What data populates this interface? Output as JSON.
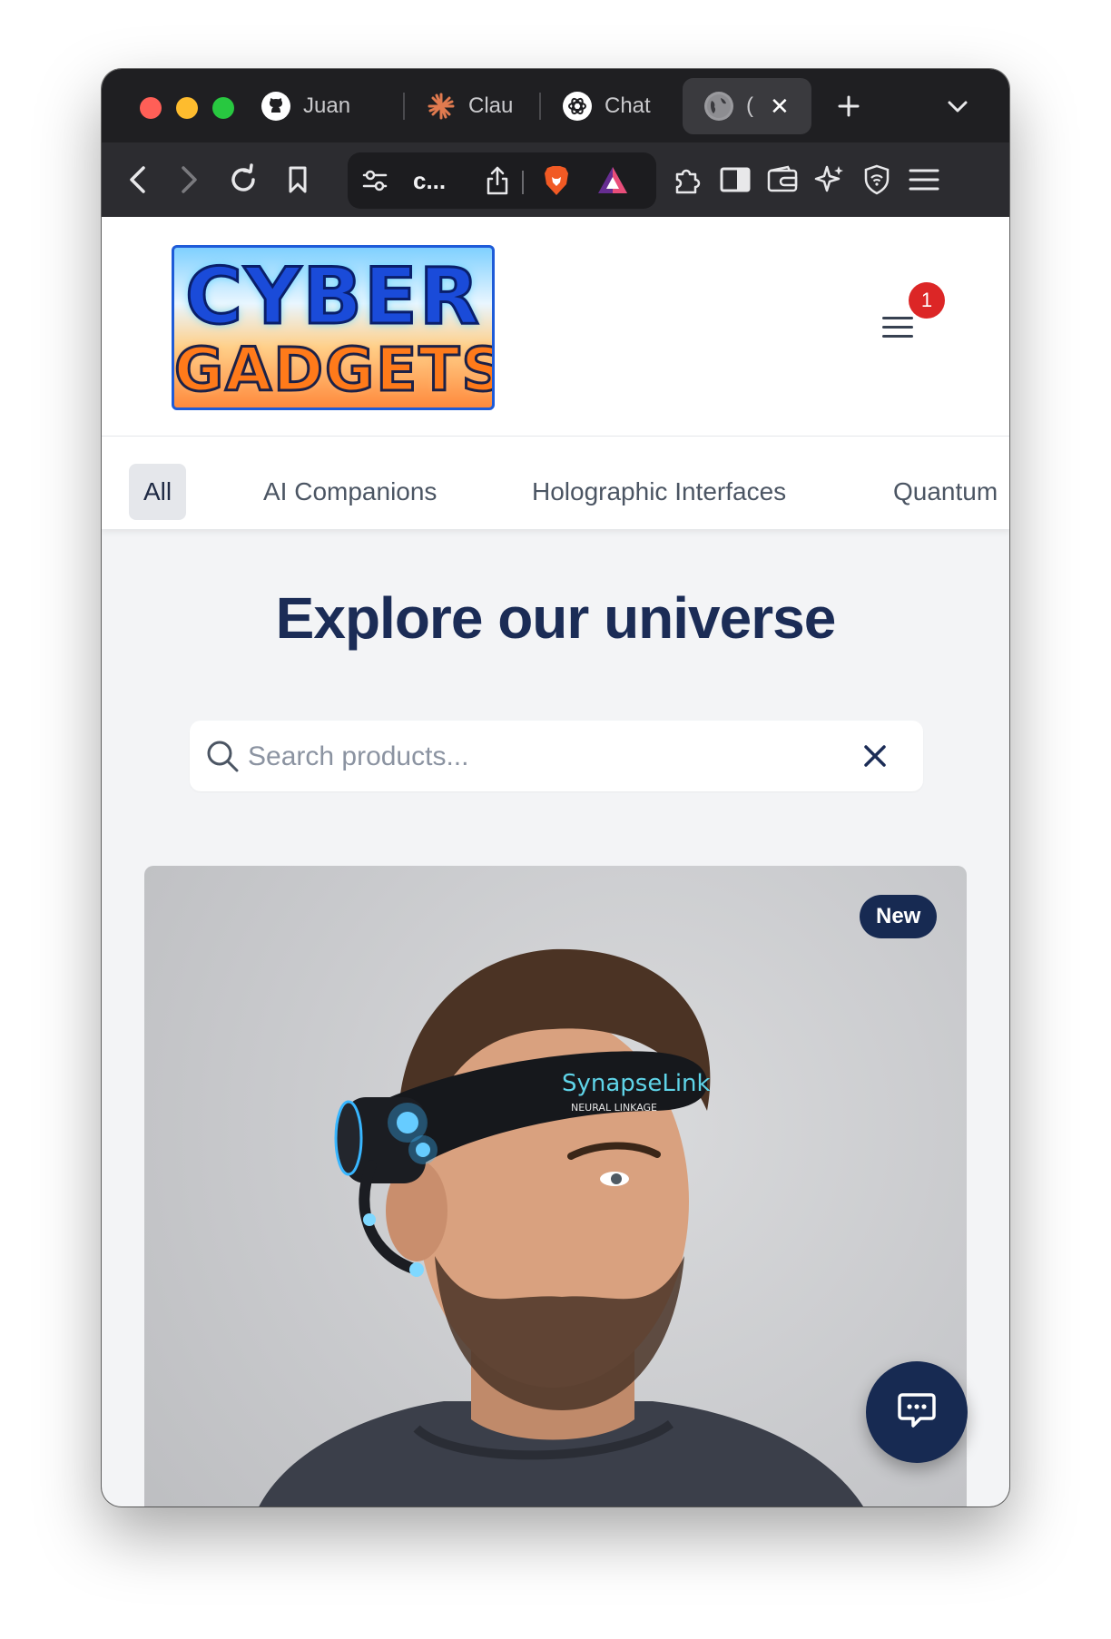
{
  "browser": {
    "tabs": [
      {
        "title": "Juan",
        "icon": "github-icon"
      },
      {
        "title": "Clau",
        "icon": "claude-icon"
      },
      {
        "title": "Chat",
        "icon": "openai-icon"
      },
      {
        "title": "(",
        "icon": "globe-icon",
        "active": true
      }
    ],
    "url": "c...",
    "colors": {
      "tabstrip": "#1f1f22",
      "toolbar": "#2c2c30",
      "brave_orange": "#f15a24"
    }
  },
  "site": {
    "logo": {
      "line1": "CYBER",
      "line2": "GADGETS"
    },
    "cart_count": "1",
    "categories": [
      {
        "label": "All",
        "active": true
      },
      {
        "label": "AI Companions"
      },
      {
        "label": "Holographic Interfaces"
      },
      {
        "label": "Quantum"
      }
    ],
    "hero_title": "Explore our universe",
    "search": {
      "placeholder": "Search products...",
      "value": ""
    },
    "product": {
      "badge": "New",
      "image_text": {
        "brand": "SynapseLink",
        "tagline": "NEURAL LINKAGE"
      }
    },
    "colors": {
      "primary": "#172a52",
      "badge_red": "#dc2626",
      "page_bg": "#f3f4f6"
    }
  }
}
